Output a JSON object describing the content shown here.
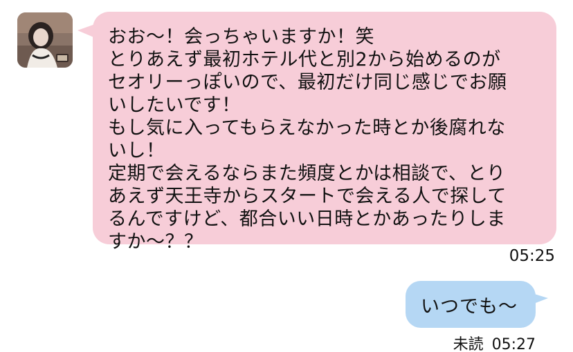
{
  "incoming": {
    "lines": [
      "おお〜！会っちゃいますか！笑",
      "とりあえず最初ホテル代と別2から始めるのが",
      "セオリーっぽいので、最初だけ同じ感じでお願",
      "いしたいです！",
      "もし気に入ってもらえなかった時とか後腐れな",
      "いし！",
      "定期で会えるならまた頻度とかは相談で、とり",
      "あえず天王寺からスタートで会える人で探して",
      "るんですけど、都合いい日時とかあったりしま",
      "すか〜？？"
    ],
    "time": "05:25",
    "bubble_color": "#f7cdd8"
  },
  "outgoing": {
    "text": "いつでも〜",
    "read_status": "未読",
    "time": "05:27",
    "bubble_color": "#b5d7f4"
  },
  "avatar": {
    "icon": "user-avatar-photo"
  }
}
